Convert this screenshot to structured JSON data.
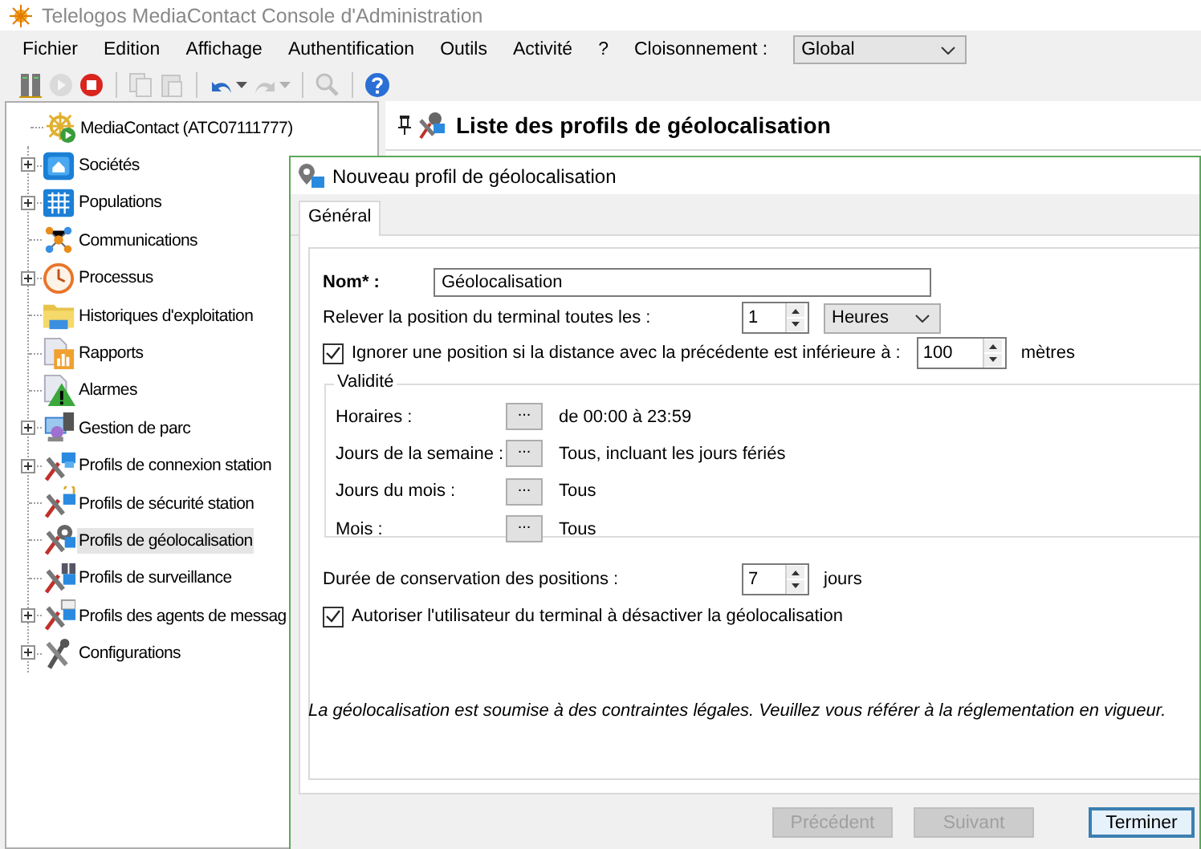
{
  "window": {
    "title": "Telelogos MediaContact Console d'Administration"
  },
  "menu": [
    "Fichier",
    "Edition",
    "Affichage",
    "Authentification",
    "Outils",
    "Activité",
    "?"
  ],
  "partition": {
    "label": "Cloisonnement :",
    "value": "Global"
  },
  "toolbar": [
    {
      "disabled": false
    },
    {
      "disabled": true
    },
    {
      "disabled": false
    },
    {
      "disabled": true
    },
    {
      "disabled": true
    },
    {
      "disabled": false
    },
    {
      "disabled": true
    },
    {
      "disabled": true
    },
    {
      "disabled": false
    }
  ],
  "tree": [
    {
      "label": "MediaContact (ATC07111777)",
      "expander": false,
      "selected": false,
      "children": [
        {
          "label": "Sociétés",
          "expander": true,
          "selected": false
        },
        {
          "label": "Populations",
          "expander": true,
          "selected": false
        },
        {
          "label": "Communications",
          "expander": false,
          "selected": false
        },
        {
          "label": "Processus",
          "expander": true,
          "selected": false
        },
        {
          "label": "Historiques d'exploitation",
          "expander": false,
          "selected": false
        },
        {
          "label": "Rapports",
          "expander": false,
          "selected": false
        },
        {
          "label": "Alarmes",
          "expander": false,
          "selected": false
        },
        {
          "label": "Gestion de parc",
          "expander": true,
          "selected": false
        },
        {
          "label": "Profils de connexion station",
          "expander": true,
          "selected": false
        },
        {
          "label": "Profils de sécurité station",
          "expander": false,
          "selected": false
        },
        {
          "label": "Profils de géolocalisation",
          "expander": false,
          "selected": true
        },
        {
          "label": "Profils de surveillance",
          "expander": false,
          "selected": false
        },
        {
          "label": "Profils des agents de messag",
          "expander": true,
          "selected": false
        },
        {
          "label": "Configurations",
          "expander": true,
          "selected": false
        }
      ]
    }
  ],
  "panel": {
    "title": "Liste des profils de géolocalisation"
  },
  "dialog": {
    "title": "Nouveau profil de géolocalisation",
    "tabs": [
      {
        "label": "Général",
        "selected": true
      }
    ],
    "name": {
      "label": "Nom* :",
      "value": "Géolocalisation"
    },
    "interval": {
      "label": "Relever la position du terminal toutes les :",
      "value": "1",
      "unit": "Heures"
    },
    "ignore": {
      "label": "Ignorer une position si la distance avec la précédente est inférieure à :",
      "checked": true,
      "value": "100",
      "unit": "mètres"
    },
    "validity": {
      "title": "Validité",
      "rows": [
        {
          "label": "Horaires :",
          "button": "...",
          "value": "de 00:00 à 23:59"
        },
        {
          "label": "Jours de la semaine :",
          "button": "...",
          "value": "Tous, incluant les jours fériés"
        },
        {
          "label": "Jours du mois :",
          "button": "...",
          "value": "Tous"
        },
        {
          "label": "Mois :",
          "button": "...",
          "value": "Tous"
        }
      ]
    },
    "retention": {
      "label": "Durée de conservation des positions :",
      "value": "7",
      "unit": "jours"
    },
    "allow_disable": {
      "label": "Autoriser l'utilisateur du terminal à désactiver la géolocalisation",
      "checked": true
    },
    "note": "La géolocalisation est soumise à des contraintes légales. Veuillez vous référer à la réglementation en vigueur.",
    "buttons": [
      {
        "label": "Précédent",
        "disabled": true,
        "default": false
      },
      {
        "label": "Suivant",
        "disabled": true,
        "default": false
      },
      {
        "label": "Terminer",
        "disabled": false,
        "default": true
      }
    ]
  }
}
